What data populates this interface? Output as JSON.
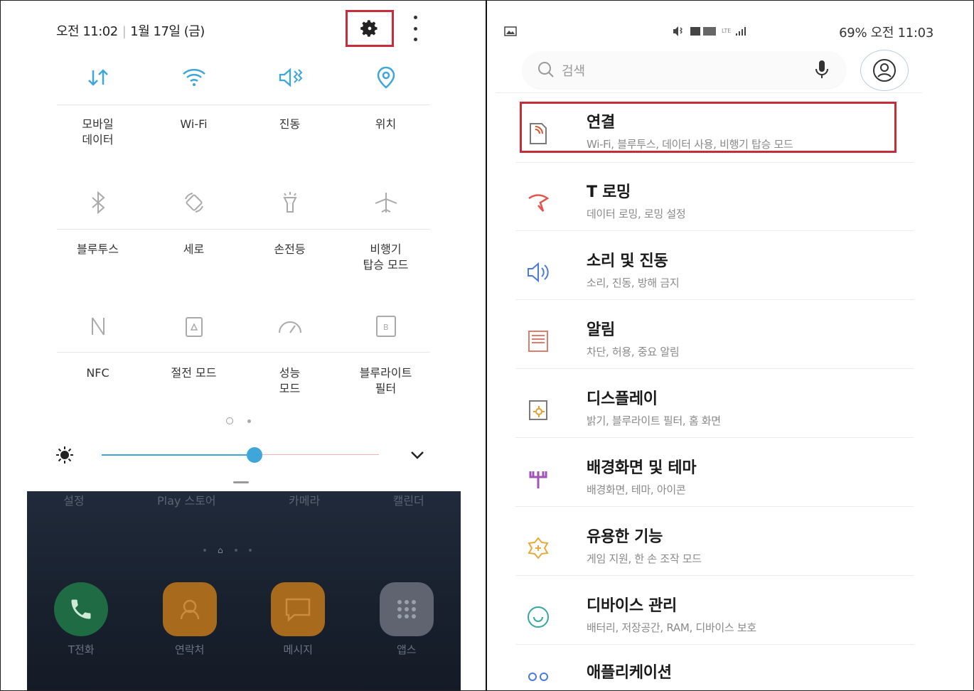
{
  "left": {
    "status": {
      "time": "오전 11:02",
      "date": "1월 17일 (금)"
    },
    "tiles": [
      {
        "icon": "mobile-data-icon",
        "label": "모바일\n데이터",
        "active": true
      },
      {
        "icon": "wifi-icon",
        "label": "Wi-Fi",
        "active": true
      },
      {
        "icon": "vibrate-icon",
        "label": "진동",
        "active": true
      },
      {
        "icon": "location-icon",
        "label": "위치",
        "active": true
      },
      {
        "icon": "bluetooth-icon",
        "label": "블루투스",
        "active": false
      },
      {
        "icon": "rotation-icon",
        "label": "세로",
        "active": false
      },
      {
        "icon": "flashlight-icon",
        "label": "손전등",
        "active": false
      },
      {
        "icon": "airplane-icon",
        "label": "비행기\n탑승 모드",
        "active": false
      },
      {
        "icon": "nfc-icon",
        "label": "NFC",
        "active": false
      },
      {
        "icon": "power-saving-icon",
        "label": "절전 모드",
        "active": false
      },
      {
        "icon": "performance-icon",
        "label": "성능\n모드",
        "active": false
      },
      {
        "icon": "blue-light-filter-icon",
        "label": "블루라이트\n필터",
        "active": false
      }
    ],
    "brightness_level": 0.55,
    "home": {
      "top_labels": [
        "설정",
        "Play 스토어",
        "카메라",
        "캘린더"
      ],
      "dock": [
        {
          "name": "T전화",
          "icon": "phone-icon",
          "color": "#1f6b44"
        },
        {
          "name": "연락처",
          "icon": "contacts-icon",
          "color": "#a86a1c"
        },
        {
          "name": "메시지",
          "icon": "message-icon",
          "color": "#a86a1c"
        },
        {
          "name": "앱스",
          "icon": "apps-icon",
          "color": "#5f6470"
        }
      ]
    }
  },
  "right": {
    "status_text": "69% 오전 11:03",
    "search_placeholder": "검색",
    "items": [
      {
        "title": "연결",
        "sub": "Wi-Fi, 블루투스, 데이터 사용, 비행기 탑승 모드",
        "icon": "connections-icon",
        "highlighted": true
      },
      {
        "title": "T 로밍",
        "sub": "데이터 로밍, 로밍 설정",
        "icon": "roaming-icon"
      },
      {
        "title": "소리 및 진동",
        "sub": "소리, 진동, 방해 금지",
        "icon": "sound-icon"
      },
      {
        "title": "알림",
        "sub": "차단, 허용, 중요 알림",
        "icon": "notifications-icon"
      },
      {
        "title": "디스플레이",
        "sub": "밝기, 블루라이트 필터, 홈 화면",
        "icon": "display-icon"
      },
      {
        "title": "배경화면 및 테마",
        "sub": "배경화면, 테마, 아이콘",
        "icon": "wallpaper-icon"
      },
      {
        "title": "유용한 기능",
        "sub": "게임 지원, 한 손 조작 모드",
        "icon": "advanced-features-icon"
      },
      {
        "title": "디바이스 관리",
        "sub": "배터리, 저장공간, RAM, 디바이스 보호",
        "icon": "device-care-icon"
      },
      {
        "title": "애플리케이션",
        "sub": "",
        "icon": "apps-settings-icon"
      }
    ]
  },
  "colors": {
    "accent": "#3ea6d8",
    "highlight": "#c62d3b"
  }
}
